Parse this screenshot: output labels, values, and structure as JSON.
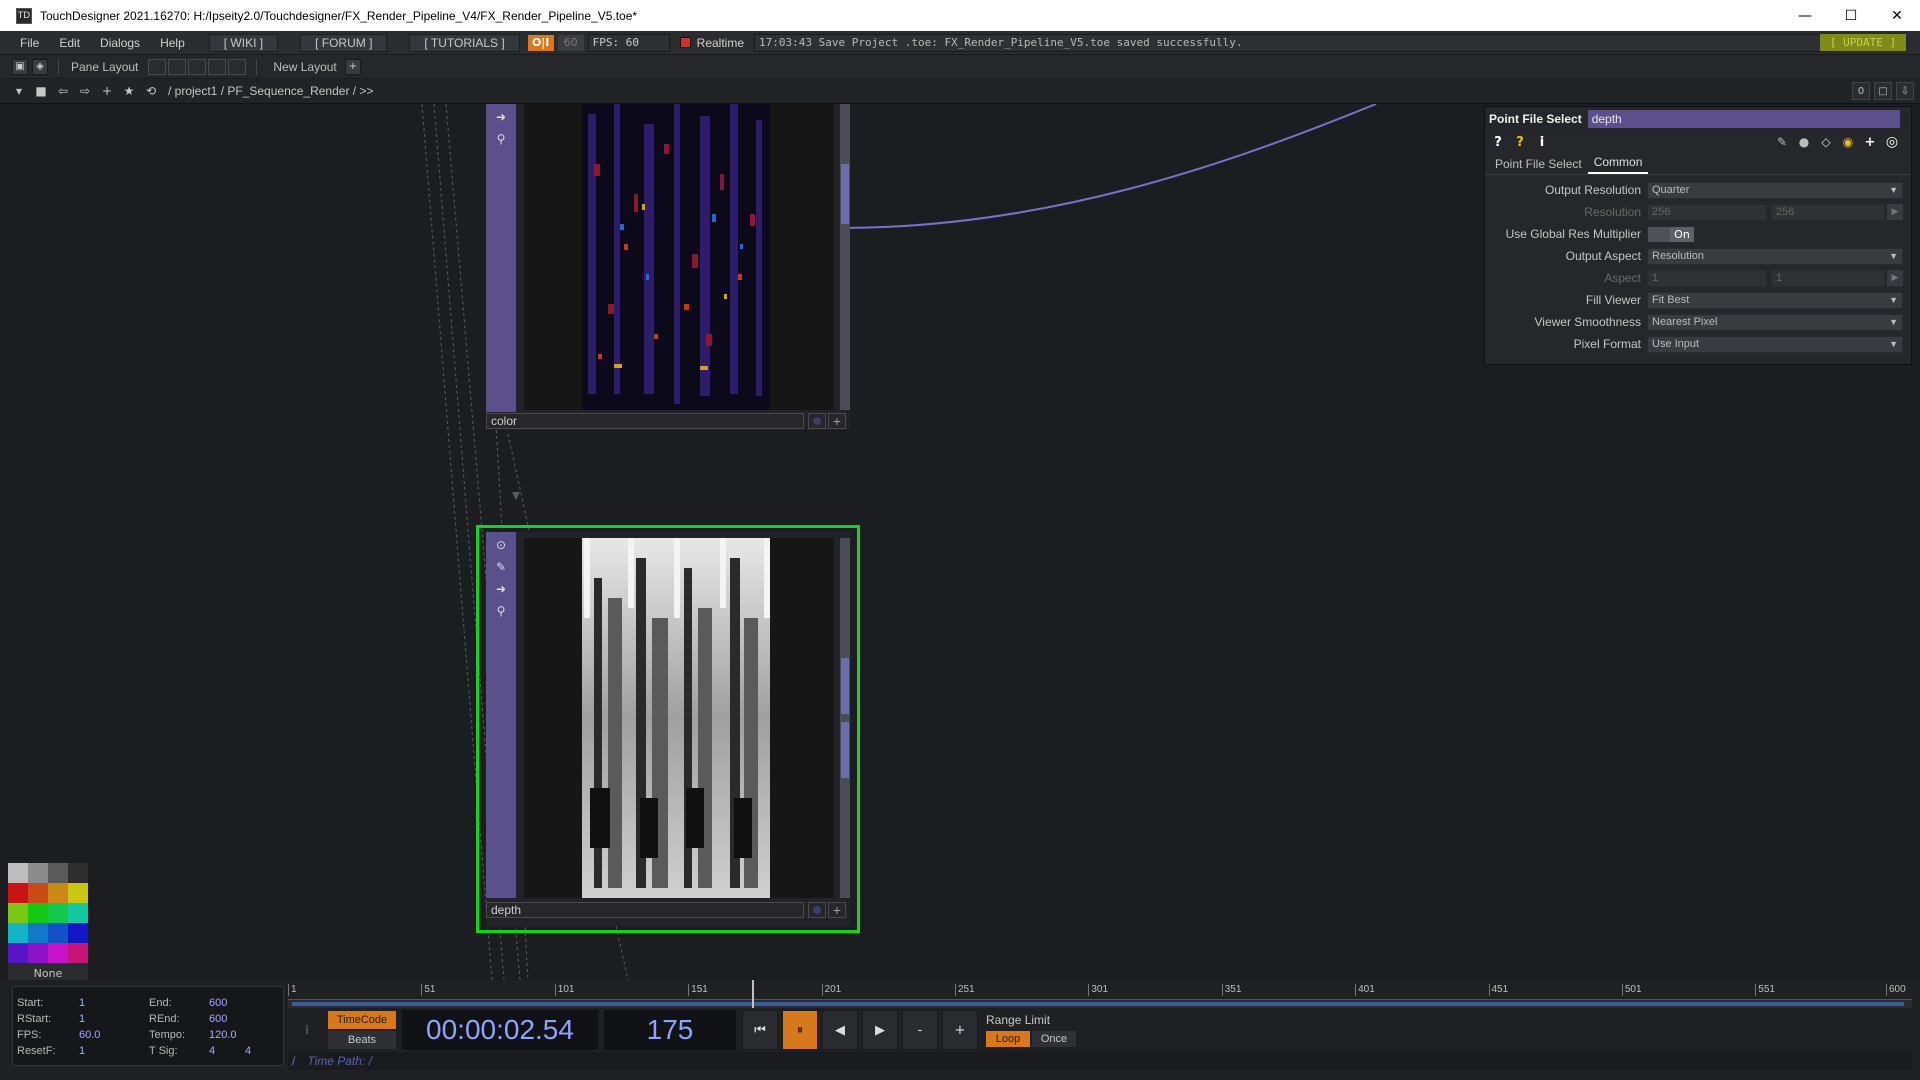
{
  "window": {
    "title": "TouchDesigner 2021.16270: H:/Ipseity2.0/Touchdesigner/FX_Render_Pipeline_V4/FX_Render_Pipeline_V5.toe*",
    "minimize": "—",
    "maximize": "☐",
    "close": "✕"
  },
  "menubar": {
    "items": [
      "File",
      "Edit",
      "Dialogs",
      "Help"
    ],
    "wiki": "[ WIKI ]",
    "forum": "[ FORUM ]",
    "tutorials": "[ TUTORIALS ]",
    "oi": "O|I",
    "fps_cap": "60",
    "fps_display": "FPS:  60",
    "realtime_label": "Realtime",
    "status": "17:03:43 Save Project .toe: FX_Render_Pipeline_V5.toe saved successfully.",
    "update": "[ UPDATE ]"
  },
  "panebar": {
    "pane_layout_label": "Pane Layout",
    "new_layout_label": "New Layout",
    "add": "+"
  },
  "pathbar": {
    "path": "/  project1  /  PF_Sequence_Render  /  >>",
    "right_value": "0"
  },
  "nodes": {
    "color": {
      "name": "color"
    },
    "depth": {
      "name": "depth"
    }
  },
  "params": {
    "op_type": "Point File Select",
    "op_name": "depth",
    "tabs": [
      "Point File Select",
      "Common"
    ],
    "rows": [
      {
        "label": "Output Resolution",
        "value": "Quarter"
      },
      {
        "label": "Resolution",
        "value": "256",
        "value2": "256"
      },
      {
        "label": "Use Global Res Multiplier",
        "value": "On"
      },
      {
        "label": "Output Aspect",
        "value": "Resolution"
      },
      {
        "label": "Aspect",
        "value": "1",
        "value2": "1"
      },
      {
        "label": "Fill Viewer",
        "value": "Fit Best"
      },
      {
        "label": "Viewer Smoothness",
        "value": "Nearest Pixel"
      },
      {
        "label": "Pixel Format",
        "value": "Use Input"
      }
    ]
  },
  "palette": {
    "none_label": "None",
    "colors": [
      "#bdbdbd",
      "#8c8c8c",
      "#5a5a5a",
      "#2e2e2e",
      "#c81414",
      "#c84a14",
      "#c88a14",
      "#c8c814",
      "#7ac814",
      "#14c814",
      "#14c84a",
      "#14c8a0",
      "#14b4c8",
      "#1478c8",
      "#1450c8",
      "#1414c8",
      "#5a14c8",
      "#8c14c8",
      "#c814c8",
      "#c81478"
    ]
  },
  "range": {
    "start_label": "Start:",
    "start": "1",
    "end_label": "End:",
    "end": "600",
    "rstart_label": "RStart:",
    "rstart": "1",
    "rend_label": "REnd:",
    "rend": "600",
    "fps_label": "FPS:",
    "fps": "60.0",
    "tempo_label": "Tempo:",
    "tempo": "120.0",
    "resetf_label": "ResetF:",
    "resetf": "1",
    "tsig_label": "T Sig:",
    "tsig_a": "4",
    "tsig_b": "4"
  },
  "timeline": {
    "ticks": [
      "1",
      "51",
      "101",
      "151",
      "201",
      "251",
      "301",
      "351",
      "401",
      "451",
      "501",
      "551",
      "600"
    ],
    "timecode_btn": "TimeCode",
    "beats_btn": "Beats",
    "timecode": "00:00:02.54",
    "frame": "175",
    "range_limit_label": "Range Limit",
    "loop": "Loop",
    "once": "Once",
    "minus": "-",
    "plus": "+",
    "time_path": "Time Path: /",
    "slash": "/"
  }
}
